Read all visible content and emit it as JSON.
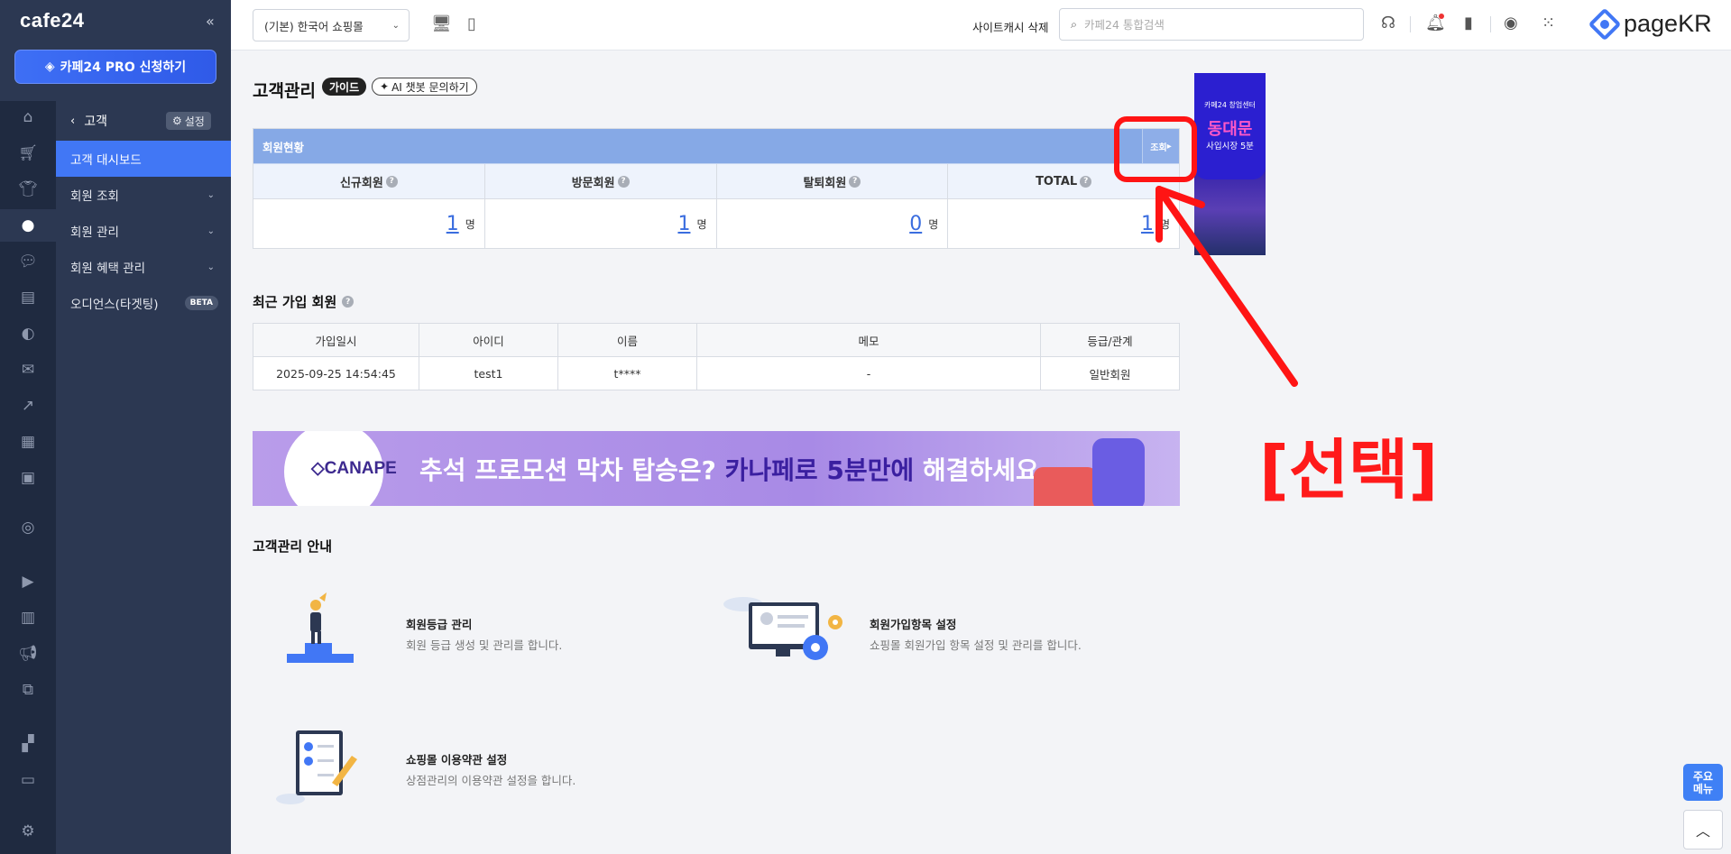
{
  "sidebar": {
    "logo": "cafe24",
    "collapse": "«",
    "pro_button": "카페24 PRO 신청하기",
    "section_title": "고객",
    "settings_label": "설정",
    "items": [
      {
        "label": "고객 대시보드"
      },
      {
        "label": "회원 조회"
      },
      {
        "label": "회원 관리"
      },
      {
        "label": "회원 혜택 관리"
      },
      {
        "label": "오디언스(타겟팅)",
        "badge": "BETA"
      }
    ]
  },
  "topbar": {
    "shop_select": "(기본) 한국어 쇼핑몰",
    "cache_delete": "사이트캐시 삭제",
    "search_placeholder": "카페24 통합검색",
    "brand": "pageKR"
  },
  "page": {
    "title": "고객관리",
    "guide": "가이드",
    "ai_chat": "AI 챗봇 문의하기"
  },
  "member_status": {
    "title": "회원현황",
    "lookup": "조회",
    "columns": [
      "신규회원",
      "방문회원",
      "탈퇴회원",
      "TOTAL"
    ],
    "values": [
      "1",
      "1",
      "0",
      "1"
    ],
    "unit": "명"
  },
  "recent": {
    "title": "최근 가입 회원",
    "headers": [
      "가입일시",
      "아이디",
      "이름",
      "메모",
      "등급/관계"
    ],
    "rows": [
      [
        "2025-09-25 14:54:45",
        "test1",
        "t****",
        "-",
        "일반회원"
      ]
    ]
  },
  "banner": {
    "logo": "CANAPE",
    "text_1": "추석 프로모션 막차 탑승은? ",
    "text_2": "카나페로 5분만에",
    "text_3": " 해결하세요"
  },
  "guide_section": {
    "title": "고객관리 안내",
    "cards": [
      {
        "title": "회원등급 관리",
        "desc": "회원 등급 생성 및 관리를 합니다."
      },
      {
        "title": "회원가입항목 설정",
        "desc": "쇼핑몰 회원가입 항목 설정 및 관리를 합니다."
      },
      {
        "title": "쇼핑몰 이용약관 설정",
        "desc": "상점관리의 이용약관 설정을 합니다."
      }
    ]
  },
  "ad": {
    "small": "카페24 창업센터",
    "main": "동대문",
    "bottom": "사입시장 5분"
  },
  "annotation": {
    "label": "[선택]",
    "color": "#ff1a1a"
  },
  "floating": {
    "quick_menu": "주요\n메뉴",
    "top": "︿"
  }
}
